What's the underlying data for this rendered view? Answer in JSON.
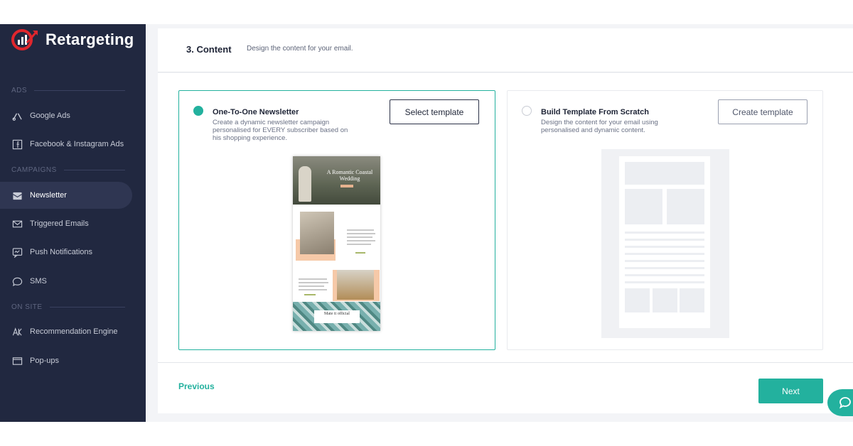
{
  "brand": {
    "name": "Retargeting",
    "accent": "#23b19e",
    "logo_red": "#e0262d"
  },
  "sidebar": {
    "sections": [
      {
        "title": "ADS",
        "items": [
          {
            "label": "Google Ads",
            "icon": "google-ads-icon"
          },
          {
            "label": "Facebook & Instagram Ads",
            "icon": "facebook-icon"
          }
        ]
      },
      {
        "title": "CAMPAIGNS",
        "items": [
          {
            "label": "Newsletter",
            "icon": "newsletter-icon",
            "active": true
          },
          {
            "label": "Triggered Emails",
            "icon": "email-icon"
          },
          {
            "label": "Push Notifications",
            "icon": "push-icon"
          },
          {
            "label": "SMS",
            "icon": "sms-icon"
          }
        ]
      },
      {
        "title": "ON SITE",
        "items": [
          {
            "label": "Recommendation Engine",
            "icon": "ai-icon"
          },
          {
            "label": "Pop-ups",
            "icon": "popup-icon"
          }
        ]
      }
    ]
  },
  "step": {
    "title": "3. Content",
    "description": "Design the content for your email."
  },
  "options": [
    {
      "title": "One-To-One Newsletter",
      "description": "Create a dynamic newsletter campaign personalised for EVERY subscriber based on his shopping experience.",
      "button": "Select template",
      "selected": true
    },
    {
      "title": "Build Template From Scratch",
      "description": "Design the content for your email using personalised and dynamic content.",
      "button": "Create template",
      "selected": false
    }
  ],
  "preview": {
    "hero_title": "A Romantic Coastal Wedding",
    "floral_label": "Mate it official"
  },
  "footer": {
    "previous": "Previous",
    "next": "Next"
  }
}
